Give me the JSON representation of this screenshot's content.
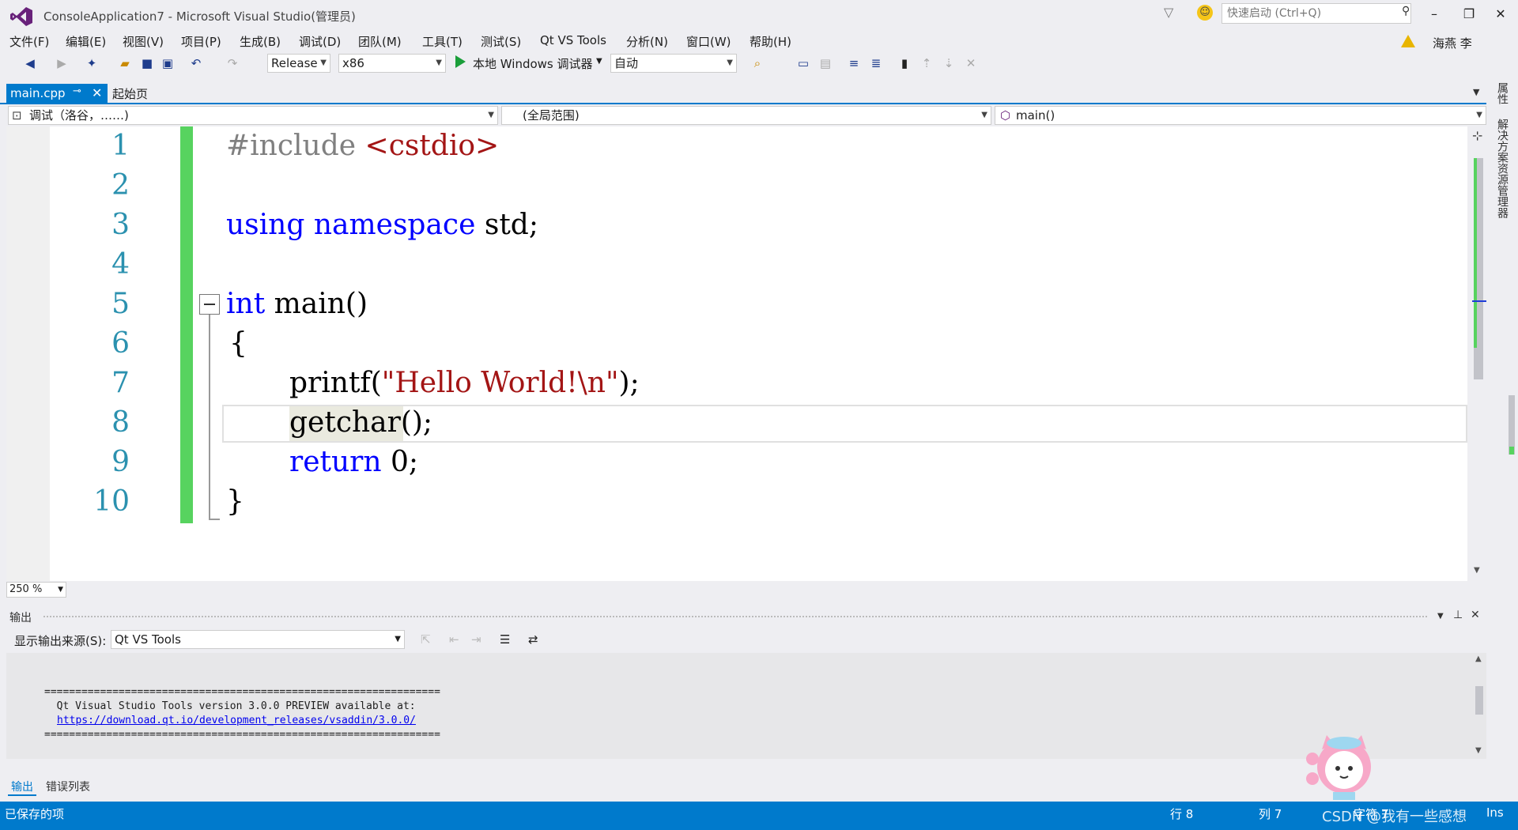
{
  "window": {
    "title": "ConsoleApplication7 - Microsoft Visual Studio(管理员)",
    "quick_launch_placeholder": "快速启动 (Ctrl+Q)",
    "user": "海燕 李",
    "minimize": "–",
    "restore": "❐",
    "close": "✕"
  },
  "menu": [
    "文件(F)",
    "编辑(E)",
    "视图(V)",
    "项目(P)",
    "生成(B)",
    "调试(D)",
    "团队(M)",
    "工具(T)",
    "测试(S)",
    "Qt VS Tools",
    "分析(N)",
    "窗口(W)",
    "帮助(H)"
  ],
  "toolbar": {
    "configuration": "Release",
    "platform": "x86",
    "debugger": "本地 Windows 调试器",
    "debugger_mode": "自动"
  },
  "tabs": {
    "active": "main.cpp",
    "other": "起始页"
  },
  "navbar": {
    "project": "调试（洛谷，……)",
    "scope": "(全局范围)",
    "member": "main()"
  },
  "editor": {
    "line_numbers": [
      "1",
      "2",
      "3",
      "4",
      "5",
      "6",
      "7",
      "8",
      "9",
      "10"
    ],
    "lines": {
      "l1_pp": "#include ",
      "l1_hdr": "<cstdio>",
      "l3_kw1": "using",
      "l3_kw2": "namespace",
      "l3_rest": " std;",
      "l5_kw": "int",
      "l5_rest": " main()",
      "l6": "{",
      "l7_fn": "printf(",
      "l7_str": "\"Hello World!\\n\"",
      "l7_end": ");",
      "l8_fn": "getchar",
      "l8_end": "();",
      "l9_kw": "return",
      "l9_rest": " 0;",
      "l10": "}"
    },
    "zoom": "250 %"
  },
  "output": {
    "title": "输出",
    "source_label": "显示输出来源(S):",
    "source_value": "Qt VS Tools",
    "separator": "================================================================",
    "message": "  Qt Visual Studio Tools version 3.0.0 PREVIEW available at:",
    "link": "https://download.qt.io/development_releases/vsaddin/3.0.0/"
  },
  "bottom_tabs": {
    "output": "输出",
    "errors": "错误列表"
  },
  "status": {
    "left": "已保存的项",
    "row": "行 8",
    "col": "列 7",
    "ch": "字符 7",
    "mode": "Ins"
  },
  "right_panels": {
    "properties": "属性",
    "solution_explorer": "解决方案资源管理器"
  },
  "watermark": "CSDN @我有一些感想"
}
